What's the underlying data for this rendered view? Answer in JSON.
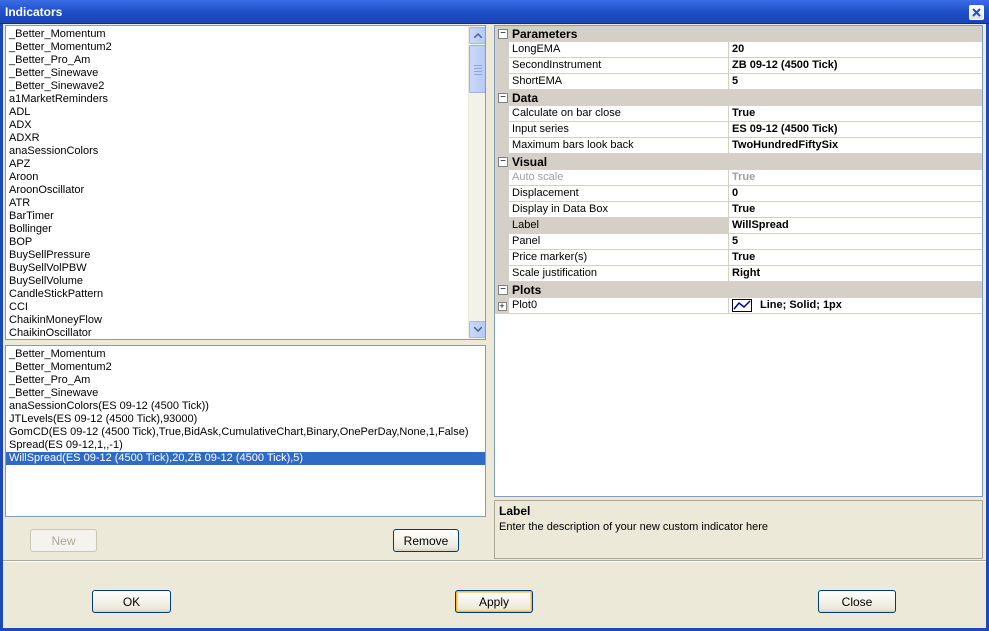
{
  "window": {
    "title": "Indicators"
  },
  "available_indicators": [
    "_Better_Momentum",
    "_Better_Momentum2",
    "_Better_Pro_Am",
    "_Better_Sinewave",
    "_Better_Sinewave2",
    "a1MarketReminders",
    "ADL",
    "ADX",
    "ADXR",
    "anaSessionColors",
    "APZ",
    "Aroon",
    "AroonOscillator",
    "ATR",
    "BarTimer",
    "Bollinger",
    "BOP",
    "BuySellPressure",
    "BuySellVolPBW",
    "BuySellVolume",
    "CandleStickPattern",
    "CCI",
    "ChaikinMoneyFlow",
    "ChaikinOscillator"
  ],
  "applied_indicators": {
    "items": [
      "_Better_Momentum",
      "_Better_Momentum2",
      "_Better_Pro_Am",
      "_Better_Sinewave",
      "anaSessionColors(ES 09-12 (4500 Tick))",
      "JTLevels(ES 09-12 (4500 Tick),93000)",
      "GomCD(ES 09-12 (4500 Tick),True,BidAsk,CumulativeChart,Binary,OnePerDay,None,1,False)",
      "Spread(ES 09-12,1,,-1)",
      "WillSpread(ES 09-12 (4500 Tick),20,ZB 09-12 (4500 Tick),5)"
    ],
    "selected_index": 8
  },
  "list_buttons": {
    "new_label": "New",
    "remove_label": "Remove"
  },
  "properties": {
    "parameters": {
      "title": "Parameters",
      "rows": [
        {
          "name": "LongEMA",
          "value": "20"
        },
        {
          "name": "SecondInstrument",
          "value": "ZB 09-12 (4500 Tick)"
        },
        {
          "name": "ShortEMA",
          "value": "5"
        }
      ]
    },
    "data": {
      "title": "Data",
      "rows": [
        {
          "name": "Calculate on bar close",
          "value": "True"
        },
        {
          "name": "Input series",
          "value": "ES 09-12 (4500 Tick)"
        },
        {
          "name": "Maximum bars look back",
          "value": "TwoHundredFiftySix"
        }
      ]
    },
    "visual": {
      "title": "Visual",
      "rows": [
        {
          "name": "Auto scale",
          "value": "True"
        },
        {
          "name": "Displacement",
          "value": "0"
        },
        {
          "name": "Display in Data Box",
          "value": "True"
        },
        {
          "name": "Label",
          "value": "WillSpread"
        },
        {
          "name": "Panel",
          "value": "5"
        },
        {
          "name": "Price marker(s)",
          "value": "True"
        },
        {
          "name": "Scale justification",
          "value": "Right"
        }
      ]
    },
    "plots": {
      "title": "Plots",
      "rows": [
        {
          "name": "Plot0",
          "value": "Line; Solid; 1px"
        }
      ]
    }
  },
  "help": {
    "title": "Label",
    "description": "Enter the description of your new custom indicator here"
  },
  "dialog_buttons": {
    "ok_label": "OK",
    "apply_label": "Apply",
    "close_label": "Close"
  },
  "colors": {
    "titlebar": "#1f50c8",
    "selection": "#316ac5",
    "category": "#d4d0c8",
    "plot_line": "#00008b"
  }
}
